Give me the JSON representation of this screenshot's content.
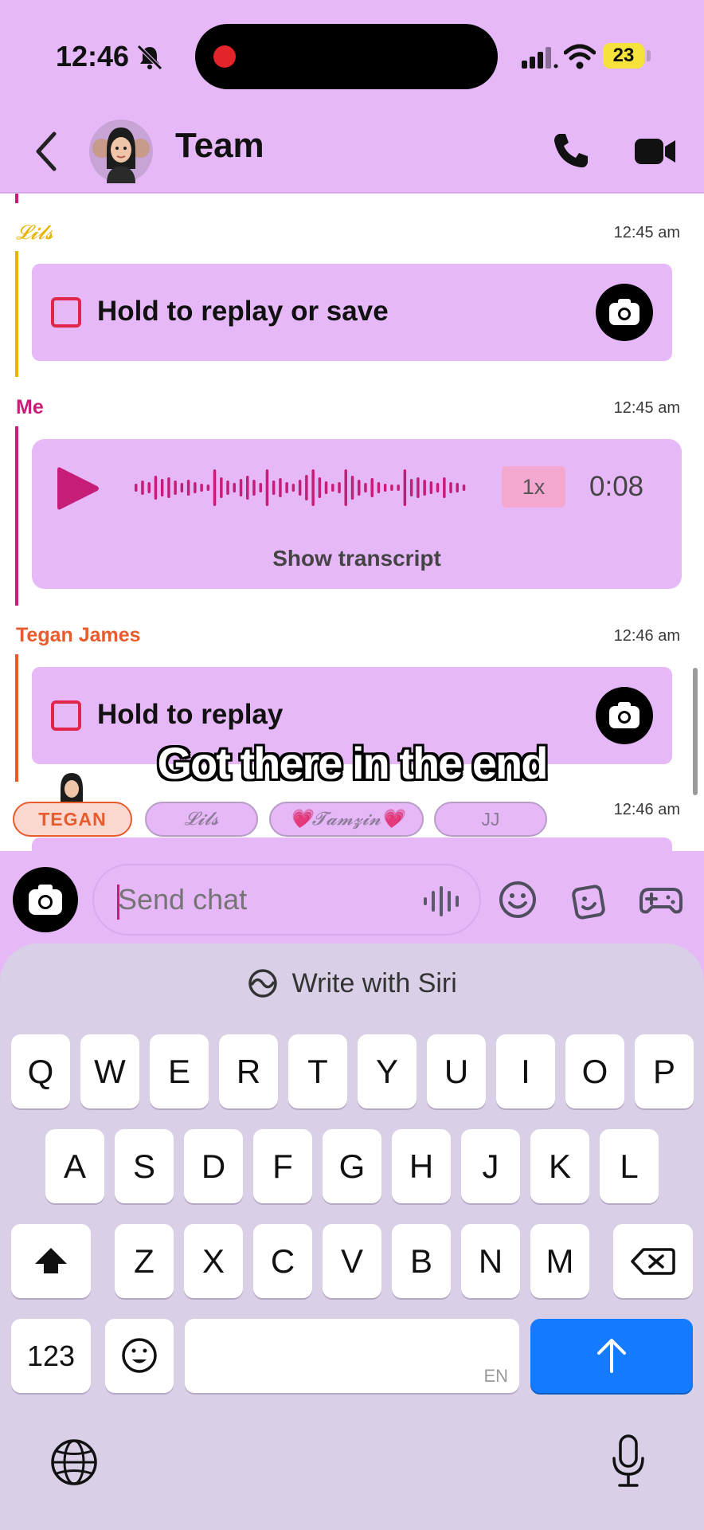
{
  "status_bar": {
    "time": "12:46",
    "battery": "23"
  },
  "header": {
    "back_icon": "chevron-left-icon",
    "title": "Team",
    "call_icon": "phone-icon",
    "video_icon": "video-camera-icon"
  },
  "messages": [
    {
      "sender": "𝓛𝓲𝓵𝓼",
      "sender_color": "#e8b400",
      "time": "12:45 am",
      "kind": "snap",
      "label": "Hold to replay or save"
    },
    {
      "sender": "Me",
      "sender_color": "#c61d78",
      "time": "12:45 am",
      "kind": "voice_note",
      "speed": "1x",
      "duration": "0:08",
      "transcript_label": "Show transcript",
      "progress": 0
    },
    {
      "sender": "Tegan James",
      "sender_color": "#e85b2c",
      "time": "12:46 am",
      "kind": "snap",
      "label": "Hold to replay"
    },
    {
      "time": "12:46 am"
    }
  ],
  "caption": "Got there in the end",
  "members": [
    {
      "label": "TEGAN",
      "active": true
    },
    {
      "label": "𝓛𝓲𝓵𝓼",
      "active": false
    },
    {
      "label": "💗𝓣𝓪𝓶𝔃𝓲𝓷💗",
      "active": false
    },
    {
      "label": "JJ",
      "active": false
    }
  ],
  "composer": {
    "placeholder": "Send chat",
    "camera_icon": "camera-icon",
    "voice_icon": "voice-wave-icon",
    "emoji_icon": "smiley-icon",
    "sticker_icon": "sticker-icon",
    "game_icon": "gamepad-icon"
  },
  "keyboard": {
    "suggestion": "Write with Siri",
    "row1": [
      "Q",
      "W",
      "E",
      "R",
      "T",
      "Y",
      "U",
      "I",
      "O",
      "P"
    ],
    "row2": [
      "A",
      "S",
      "D",
      "F",
      "G",
      "H",
      "J",
      "K",
      "L"
    ],
    "row3": [
      "Z",
      "X",
      "C",
      "V",
      "B",
      "N",
      "M"
    ],
    "numbers_key": "123",
    "space_lang": "EN",
    "accent": "#147aff"
  }
}
